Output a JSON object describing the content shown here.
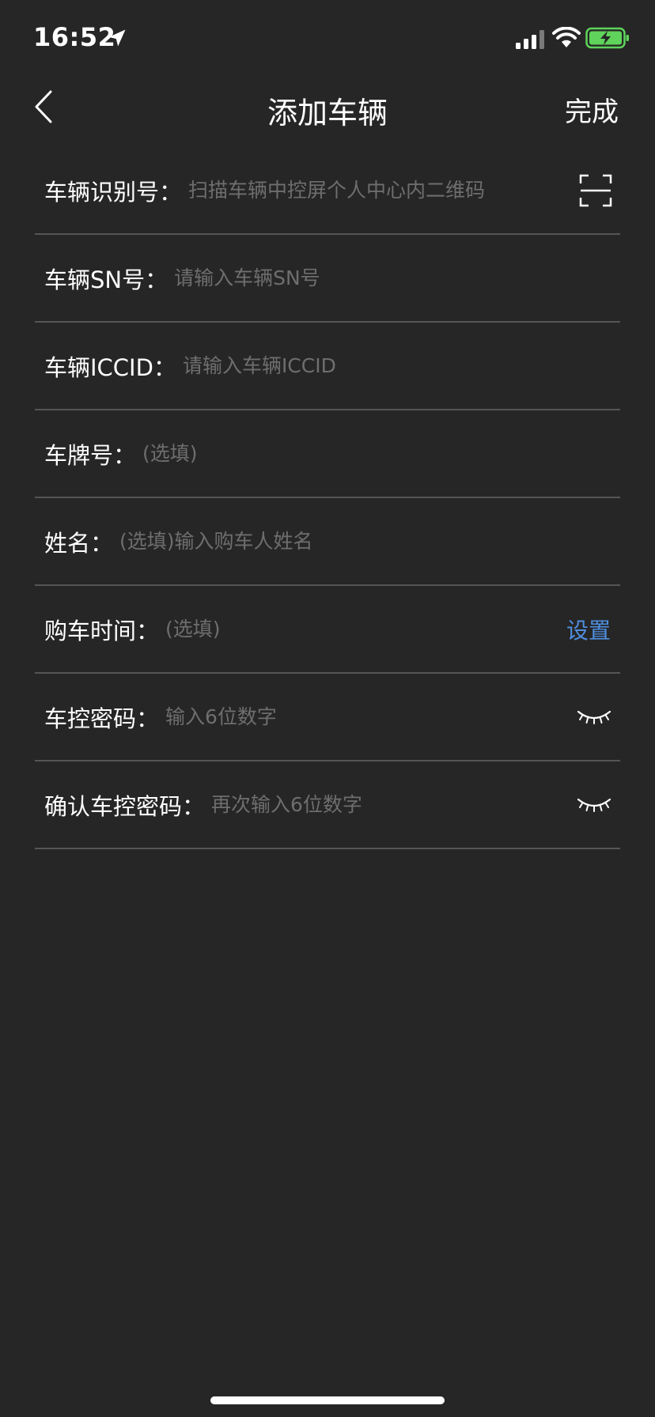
{
  "status_bar": {
    "time": "16:52",
    "location_icon": "location-arrow-icon",
    "signal_icon": "cellular-signal-icon",
    "wifi_icon": "wifi-icon",
    "battery_icon": "battery-charging-icon",
    "battery_color": "#5fd35b"
  },
  "nav": {
    "back_icon": "chevron-left-icon",
    "title": "添加车辆",
    "done_label": "完成"
  },
  "form": {
    "vin": {
      "label": "车辆识别号：",
      "placeholder": "扫描车辆中控屏个人中心内二维码",
      "action_icon": "scan-qr-icon"
    },
    "sn": {
      "label": "车辆SN号：",
      "placeholder": "请输入车辆SN号"
    },
    "iccid": {
      "label": "车辆ICCID：",
      "placeholder": "请输入车辆ICCID"
    },
    "plate": {
      "label": "车牌号：",
      "placeholder": "(选填)"
    },
    "name": {
      "label": "姓名：",
      "placeholder": "(选填)输入购车人姓名"
    },
    "purchase_time": {
      "label": "购车时间：",
      "placeholder": "(选填)",
      "action_label": "设置"
    },
    "control_password": {
      "label": "车控密码：",
      "placeholder": "输入6位数字",
      "action_icon": "eye-closed-icon"
    },
    "confirm_password": {
      "label": "确认车控密码：",
      "placeholder": "再次输入6位数字",
      "action_icon": "eye-closed-icon"
    }
  },
  "colors": {
    "background": "#262626",
    "divider": "#555555",
    "placeholder": "#6e6e6e",
    "link": "#4f8fe0",
    "text": "#ffffff"
  }
}
